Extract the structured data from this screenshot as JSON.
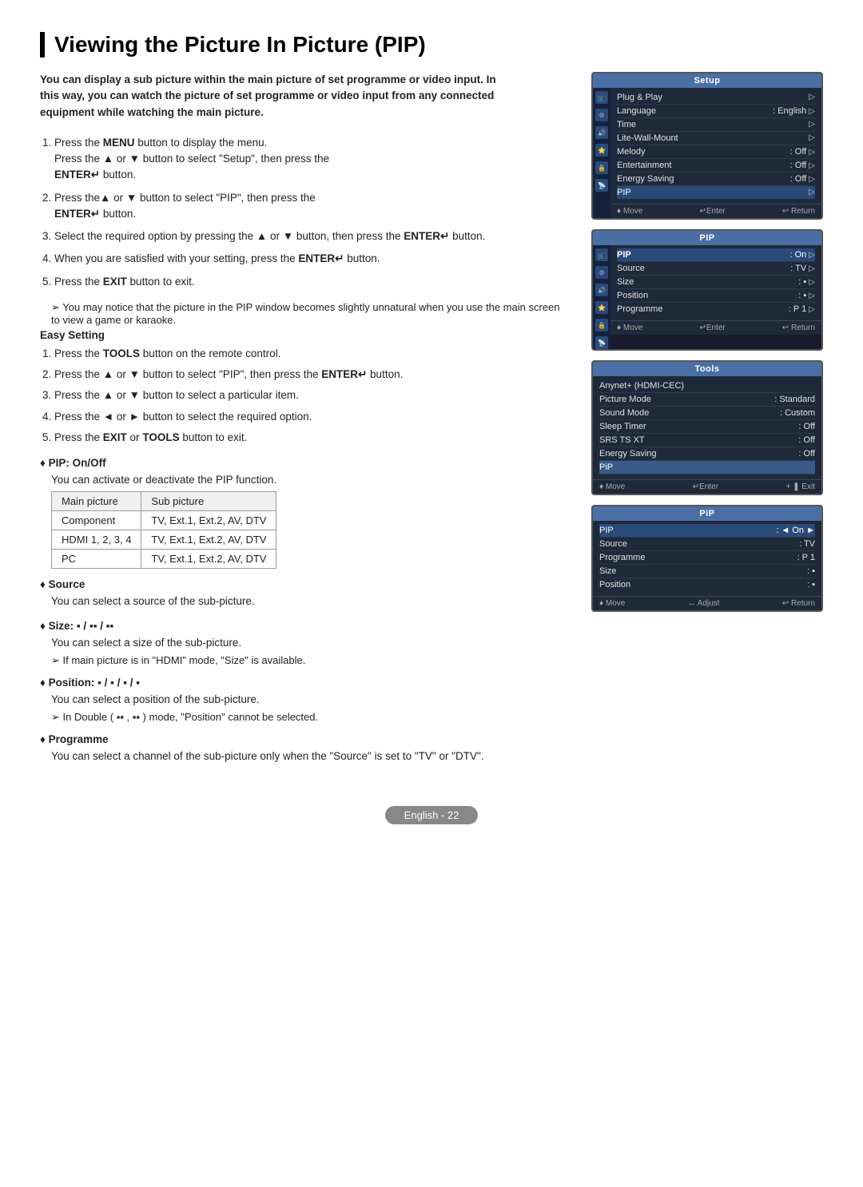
{
  "page": {
    "title": "Viewing the Picture In Picture (PIP)",
    "intro": "You can display a sub picture within the main picture of set programme or video input. In this way, you can watch the picture of set programme or video input from any connected equipment while watching the main picture."
  },
  "steps": [
    {
      "id": 1,
      "text": "Press the MENU button to display the menu. Press the ▲ or ▼ button to select \"Setup\", then press the ENTER↵ button."
    },
    {
      "id": 2,
      "text": "Press the ▲ or ▼ button to select \"PIP\", then press the ENTER↵ button."
    },
    {
      "id": 3,
      "text": "Select the required option by pressing the ▲ or ▼ button, then press the ENTER↵ button."
    },
    {
      "id": 4,
      "text": "When you are satisfied with your setting, press the ENTER↵ button."
    },
    {
      "id": 5,
      "text": "Press the EXIT button to exit."
    }
  ],
  "note1": "You may notice that the picture in the PIP window becomes slightly unnatural when you use the main screen to view a game or karaoke.",
  "easy_setting": {
    "title": "Easy Setting",
    "steps": [
      "Press the TOOLS button on the remote control.",
      "Press the ▲ or ▼ button to select \"PIP\", then press the ENTER↵ button.",
      "Press the ▲ or ▼ button to select a particular item.",
      "Press the ◄ or ► button to select the required option.",
      "Press the EXIT or TOOLS button to exit."
    ]
  },
  "pip_onoff": {
    "title": "PIP: On/Off",
    "body": "You can activate or deactivate the PIP function.",
    "table": {
      "headers": [
        "Main picture",
        "Sub picture"
      ],
      "rows": [
        [
          "Component",
          "TV, Ext.1, Ext.2, AV, DTV"
        ],
        [
          "HDMI 1, 2, 3, 4",
          "TV, Ext.1, Ext.2, AV, DTV"
        ],
        [
          "PC",
          "TV, Ext.1, Ext.2, AV, DTV"
        ]
      ]
    }
  },
  "source": {
    "title": "Source",
    "body": "You can select a source of the  sub-picture."
  },
  "size": {
    "title": "Size: □ / □□ / □□",
    "body": "You can select a size of the sub-picture.",
    "note": "If main picture is in \"HDMI\" mode, \"Size\" is available."
  },
  "position": {
    "title": "Position: □ / □ / □ / □",
    "body": "You can select a position of the sub-picture.",
    "note": "In Double ( □□ , □□ ) mode, \"Position\" cannot be selected."
  },
  "programme": {
    "title": "Programme",
    "body": "You can select a channel of the sub-picture only when the \"Source\" is set to \"TV\" or \"DTV\"."
  },
  "screens": {
    "setup": {
      "title": "Setup",
      "tv_label": "TV",
      "rows": [
        {
          "label": "Plug & Play",
          "value": ""
        },
        {
          "label": "Language",
          "value": ": English"
        },
        {
          "label": "Time",
          "value": ""
        },
        {
          "label": "Lite-Wall-Mount",
          "value": ""
        },
        {
          "label": "Melody",
          "value": ": Off"
        },
        {
          "label": "Entertainment",
          "value": ": Off"
        },
        {
          "label": "Energy Saving",
          "value": ": Off"
        },
        {
          "label": "PIP",
          "value": ""
        }
      ],
      "footer": [
        "♦ Move",
        "↵Enter",
        "↩ Return"
      ]
    },
    "pip": {
      "title": "PIP",
      "tv_label": "TV",
      "rows": [
        {
          "label": "PIP",
          "value": ": On"
        },
        {
          "label": "Source",
          "value": ": TV"
        },
        {
          "label": "Size",
          "value": ": □"
        },
        {
          "label": "Position",
          "value": ": □"
        },
        {
          "label": "Programme",
          "value": ": P 1"
        }
      ],
      "footer": [
        "♦ Move",
        "↵Enter",
        "↩ Return"
      ]
    },
    "tools": {
      "title": "Tools",
      "rows": [
        {
          "label": "Anynet+ (HDMI-CEC)",
          "value": ""
        },
        {
          "label": "Picture Mode",
          "value": ": Standard"
        },
        {
          "label": "Sound Mode",
          "value": ": Custom"
        },
        {
          "label": "Sleep Timer",
          "value": ": Off"
        },
        {
          "label": "SRS TS XT",
          "value": ": Off"
        },
        {
          "label": "Energy Saving",
          "value": ": Off"
        },
        {
          "label": "PiP",
          "value": "",
          "highlight": true
        }
      ],
      "footer": [
        "♦ Move",
        "↵Enter",
        "+ ❚ Exit"
      ]
    },
    "pip2": {
      "title": "PiP",
      "rows": [
        {
          "label": "PIP",
          "col": ":",
          "value": "◄ On ►"
        },
        {
          "label": "Source",
          "col": ":",
          "value": "TV"
        },
        {
          "label": "Programme",
          "col": ":",
          "value": "P 1"
        },
        {
          "label": "Size",
          "col": ":",
          "value": "□"
        },
        {
          "label": "Position",
          "col": ":",
          "value": "□"
        }
      ],
      "footer": [
        "♦ Move",
        "↔ Adjust",
        "↩ Return"
      ]
    }
  },
  "footer": {
    "label": "English - 22"
  }
}
